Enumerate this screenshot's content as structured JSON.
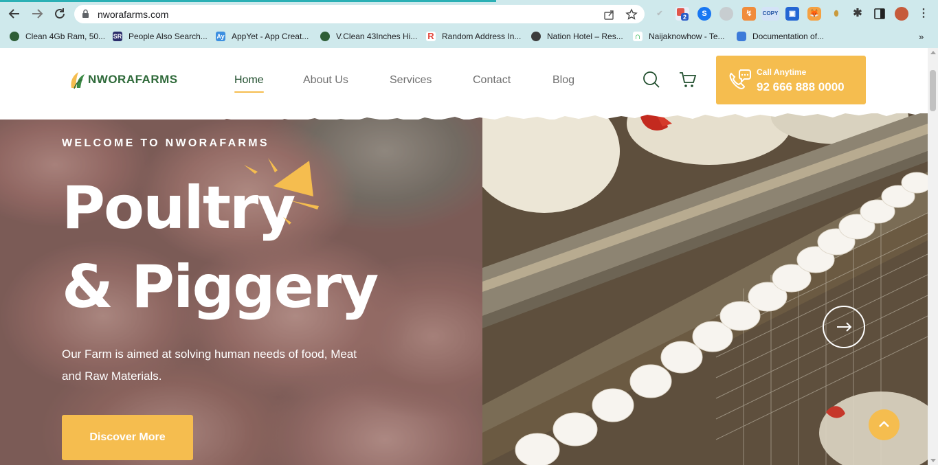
{
  "browser": {
    "url": "nworafarms.com",
    "extensions": {
      "badge_count": "2",
      "copy_label": "COPY"
    },
    "bookmarks": [
      {
        "label": "Clean 4Gb Ram, 50...",
        "icon": "leaf-globe-icon"
      },
      {
        "label": "People Also Search...",
        "icon": "sr-icon"
      },
      {
        "label": "AppYet - App Creat...",
        "icon": "appyet-icon"
      },
      {
        "label": "V.Clean 43Inches Hi...",
        "icon": "leaf-globe-icon"
      },
      {
        "label": "Random Address In...",
        "icon": "r-icon"
      },
      {
        "label": "Nation Hotel – Res...",
        "icon": "globe-icon"
      },
      {
        "label": "Naijaknowhow - Te...",
        "icon": "n-icon"
      },
      {
        "label": "Documentation of...",
        "icon": "doc-icon"
      }
    ]
  },
  "site": {
    "logo_text": "NWORAFARMS",
    "nav": [
      {
        "label": "Home",
        "active": true
      },
      {
        "label": "About Us",
        "active": false
      },
      {
        "label": "Services",
        "active": false
      },
      {
        "label": "Contact",
        "active": false
      },
      {
        "label": "Blog",
        "active": false
      }
    ],
    "call": {
      "label": "Call Anytime",
      "number": "92 666 888 0000"
    }
  },
  "hero": {
    "eyebrow": "WELCOME TO NWORAFARMS",
    "title_line1": "Poultry",
    "title_line2": "& Piggery",
    "description": "Our Farm is aimed at solving human needs of food, Meat and Raw Materials.",
    "cta": "Discover More"
  },
  "colors": {
    "accent": "#f5bd4f",
    "brand_green": "#2f6a3a",
    "nav_active": "#1f4d2c",
    "nav_text": "#6f6f6f",
    "chrome_bg": "#cfe9ec"
  }
}
